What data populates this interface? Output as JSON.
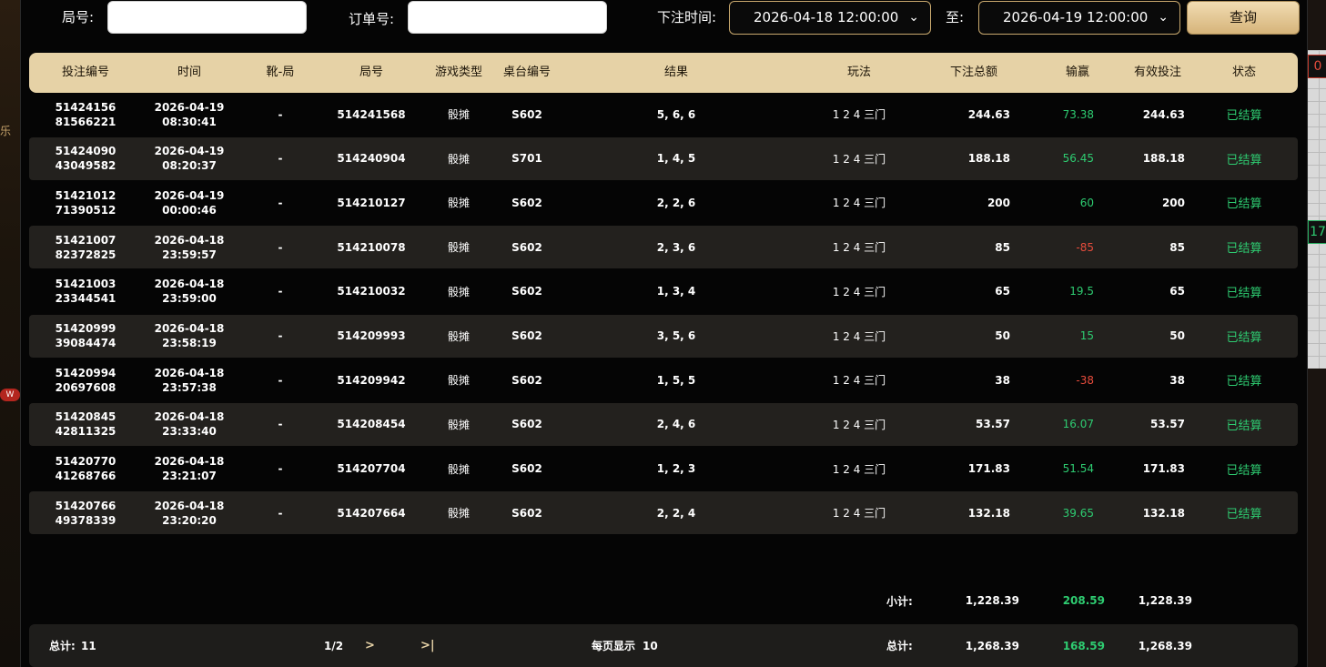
{
  "filters": {
    "round_label": "局号:",
    "round_value": "",
    "order_label": "订单号:",
    "order_value": "",
    "time_label": "下注时间:",
    "start_time": "2026-04-18 12:00:00",
    "to_label": "至:",
    "end_time": "2026-04-19 12:00:00",
    "query_label": "查询"
  },
  "table": {
    "headers": [
      "投注编号",
      "时间",
      "靴-局",
      "局号",
      "游戏类型",
      "桌台编号",
      "结果",
      "玩法",
      "下注总额",
      "输赢",
      "有效投注",
      "状态"
    ],
    "rows": [
      {
        "id1": "51424156",
        "id2": "81566221",
        "date": "2026-04-19",
        "time": "08:30:41",
        "shoe": "-",
        "round": "514241568",
        "game": "骰摊",
        "table": "S602",
        "result": "5, 6, 6",
        "play": "1 2 4 三门",
        "total": "244.63",
        "winloss": "73.38",
        "valid": "244.63",
        "status": "已结算"
      },
      {
        "id1": "51424090",
        "id2": "43049582",
        "date": "2026-04-19",
        "time": "08:20:37",
        "shoe": "-",
        "round": "514240904",
        "game": "骰摊",
        "table": "S701",
        "result": "1, 4, 5",
        "play": "1 2 4 三门",
        "total": "188.18",
        "winloss": "56.45",
        "valid": "188.18",
        "status": "已结算"
      },
      {
        "id1": "51421012",
        "id2": "71390512",
        "date": "2026-04-19",
        "time": "00:00:46",
        "shoe": "-",
        "round": "514210127",
        "game": "骰摊",
        "table": "S602",
        "result": "2, 2, 6",
        "play": "1 2 4 三门",
        "total": "200",
        "winloss": "60",
        "valid": "200",
        "status": "已结算"
      },
      {
        "id1": "51421007",
        "id2": "82372825",
        "date": "2026-04-18",
        "time": "23:59:57",
        "shoe": "-",
        "round": "514210078",
        "game": "骰摊",
        "table": "S602",
        "result": "2, 3, 6",
        "play": "1 2 4 三门",
        "total": "85",
        "winloss": "-85",
        "valid": "85",
        "status": "已结算"
      },
      {
        "id1": "51421003",
        "id2": "23344541",
        "date": "2026-04-18",
        "time": "23:59:00",
        "shoe": "-",
        "round": "514210032",
        "game": "骰摊",
        "table": "S602",
        "result": "1, 3, 4",
        "play": "1 2 4 三门",
        "total": "65",
        "winloss": "19.5",
        "valid": "65",
        "status": "已结算"
      },
      {
        "id1": "51420999",
        "id2": "39084474",
        "date": "2026-04-18",
        "time": "23:58:19",
        "shoe": "-",
        "round": "514209993",
        "game": "骰摊",
        "table": "S602",
        "result": "3, 5, 6",
        "play": "1 2 4 三门",
        "total": "50",
        "winloss": "15",
        "valid": "50",
        "status": "已结算"
      },
      {
        "id1": "51420994",
        "id2": "20697608",
        "date": "2026-04-18",
        "time": "23:57:38",
        "shoe": "-",
        "round": "514209942",
        "game": "骰摊",
        "table": "S602",
        "result": "1, 5, 5",
        "play": "1 2 4 三门",
        "total": "38",
        "winloss": "-38",
        "valid": "38",
        "status": "已结算"
      },
      {
        "id1": "51420845",
        "id2": "42811325",
        "date": "2026-04-18",
        "time": "23:33:40",
        "shoe": "-",
        "round": "514208454",
        "game": "骰摊",
        "table": "S602",
        "result": "2, 4, 6",
        "play": "1 2 4 三门",
        "total": "53.57",
        "winloss": "16.07",
        "valid": "53.57",
        "status": "已结算"
      },
      {
        "id1": "51420770",
        "id2": "41268766",
        "date": "2026-04-18",
        "time": "23:21:07",
        "shoe": "-",
        "round": "514207704",
        "game": "骰摊",
        "table": "S602",
        "result": "1, 2, 3",
        "play": "1 2 4 三门",
        "total": "171.83",
        "winloss": "51.54",
        "valid": "171.83",
        "status": "已结算"
      },
      {
        "id1": "51420766",
        "id2": "49378339",
        "date": "2026-04-18",
        "time": "23:20:20",
        "shoe": "-",
        "round": "514207664",
        "game": "骰摊",
        "table": "S602",
        "result": "2, 2, 4",
        "play": "1 2 4 三门",
        "total": "132.18",
        "winloss": "39.65",
        "valid": "132.18",
        "status": "已结算"
      }
    ]
  },
  "subtotal": {
    "label": "小计:",
    "total": "1,228.39",
    "winloss": "208.59",
    "valid": "1,228.39"
  },
  "footer": {
    "count_label": "总计:",
    "count_value": "11",
    "page": "1/2",
    "next": ">",
    "last": ">|",
    "per_page_label": "每页显示",
    "per_page_value": "10",
    "total_label": "总计:",
    "total": "1,268.39",
    "winloss": "168.59",
    "valid": "1,268.39"
  },
  "background": {
    "left_marks": [
      "乐",
      "W"
    ],
    "right_badges": [
      "0",
      "17"
    ]
  },
  "colors": {
    "header_gold": "#e6d2a6",
    "win_green": "#2ecc71",
    "loss_red": "#e74c3c",
    "button_gold": "#d6b47a"
  },
  "icons": {
    "dropdown": "chevron-down-icon"
  }
}
